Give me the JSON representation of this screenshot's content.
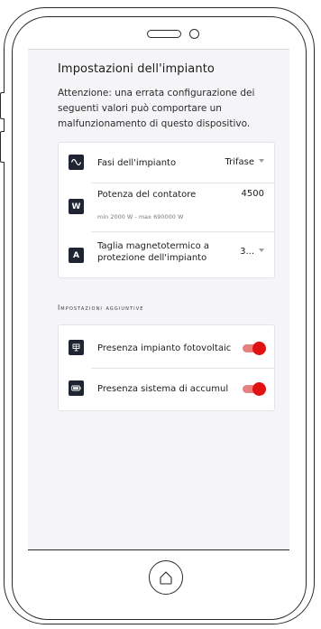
{
  "screen": {
    "title": "Impostazioni dell'impianto",
    "warning": "Attenzione: una errata configurazione dei seguenti valori può comportare un malfunzionamento di questo dispositivo."
  },
  "plant_settings": {
    "phases": {
      "label": "Fasi dell'impianto",
      "value": "Trifase",
      "icon": "sine-wave-icon"
    },
    "meter_power": {
      "label": "Potenza del contatore",
      "value": "4500",
      "hint": "min 2000 W - max 690000 W",
      "icon": "w-letter-icon",
      "icon_text": "W"
    },
    "breaker_size": {
      "label_line1": "Taglia magnetotermico a",
      "label_line2": "protezione dell'impianto",
      "value": "3...",
      "icon": "a-letter-icon",
      "icon_text": "A"
    }
  },
  "additional": {
    "section_title": "Impostazioni aggiuntive",
    "photovoltaic": {
      "label": "Presenza impianto fotovoltaic",
      "enabled": true,
      "icon": "solar-panel-icon"
    },
    "storage": {
      "label": "Presenza sistema di accumul",
      "enabled": true,
      "icon": "battery-icon"
    }
  },
  "colors": {
    "accent": "#e01212",
    "toggle_track": "#e98080",
    "icon_bg": "#1f2433",
    "screen_bg": "#f5f5f7"
  }
}
